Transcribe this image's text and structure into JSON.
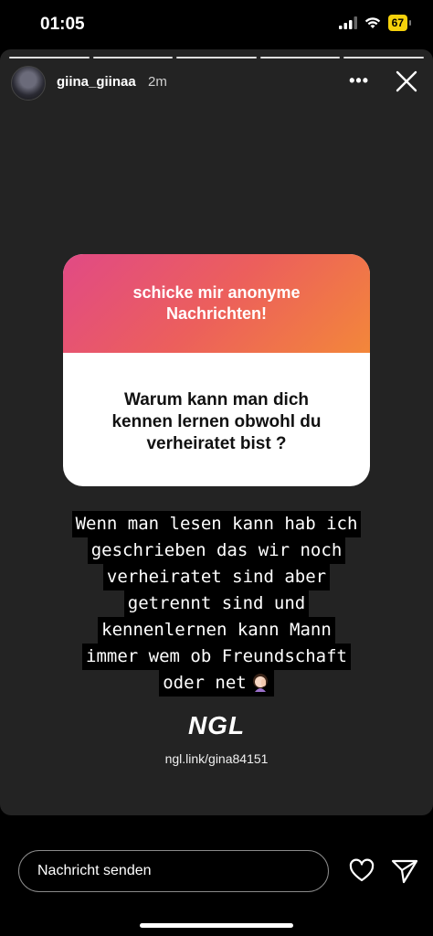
{
  "status": {
    "time": "01:05",
    "battery": "67"
  },
  "story": {
    "username": "giina_giinaa",
    "time_ago": "2m",
    "progress_segments": 5,
    "card": {
      "title": "schicke mir anonyme\nNachrichten!",
      "question": "Warum kann man dich\nkennen lernen obwohl du\nverheiratet bist ?"
    },
    "caption_lines": [
      "Wenn man lesen kann hab ich",
      "geschrieben das wir noch",
      "verheiratet sind aber",
      "getrennt sind und",
      "kennenlernen kann Mann",
      "immer wem ob Freundschaft",
      "oder net"
    ],
    "logo": "NGL",
    "link": "ngl.link/gina84151"
  },
  "reply": {
    "placeholder": "Nachricht senden"
  },
  "icons": {
    "more": "more-icon",
    "close": "close-icon",
    "heart": "heart-icon",
    "send": "send-icon",
    "emoji": "facepalm-woman-emoji"
  }
}
